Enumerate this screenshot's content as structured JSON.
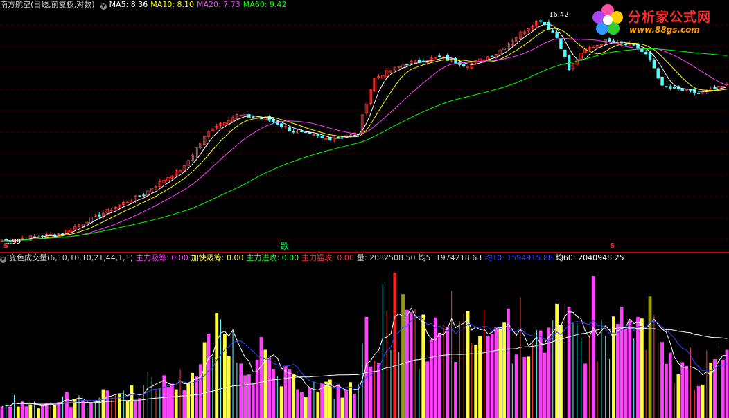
{
  "price_header": {
    "stock_title": "南方航空(日线,前复权,对数)",
    "ma5": "MA5: 8.36",
    "ma10": "MA10: 8.10",
    "ma20": "MA20: 7.73",
    "ma60": "MA60: 9.42"
  },
  "volume_header": {
    "indicator": "变色成交量(6,10,10,10,21,44,1,1)",
    "zhuli_xichou": "主力吸筹: 0.00",
    "jiakuai_xichou": "加快吸筹: 0.00",
    "zhuli_jingong": "主力进攻: 0.00",
    "zhuli_menggong": "主力猛攻: 0.00",
    "liang": "量: 2082508.50",
    "jun5": "均5: 1974218.63",
    "jun10": "均10: 1594915.88",
    "jun60": "均60: 2040948.25"
  },
  "price_markers": {
    "high_label": "16.42",
    "low_label": "1.99",
    "die": "跌",
    "s_left": "S",
    "s_right": "S"
  },
  "logo": {
    "brand": "分析家公式网",
    "url": "www.88gs.com",
    "icon": "flower-icon"
  },
  "colors": {
    "background": "#000000",
    "up_candle": "#ff3c3c",
    "down_candle": "#54ffff",
    "ma5": "#ffffff",
    "ma10": "#ffff00",
    "ma20": "#ff40ff",
    "ma60": "#00ff00",
    "vol_magenta": "#ff40ff",
    "vol_yellow": "#ffff40",
    "vol_olive": "#999900",
    "vol_red": "#ff2020",
    "vol_avg_white": "#ffffff",
    "vol_avg_blue": "#3344ff"
  },
  "chart_data": [
    {
      "type": "line",
      "panel": "price (candlestick, log scale)",
      "y_scale": "log",
      "ylim": [
        1.95,
        17.5
      ],
      "grid": "dotted horizontal",
      "bars": 180,
      "close_keypoints": [
        [
          0,
          2.0
        ],
        [
          15,
          2.15
        ],
        [
          25,
          2.6
        ],
        [
          35,
          3.1
        ],
        [
          45,
          4.0
        ],
        [
          52,
          5.8
        ],
        [
          58,
          6.5
        ],
        [
          65,
          6.3
        ],
        [
          72,
          5.6
        ],
        [
          80,
          5.2
        ],
        [
          88,
          5.5
        ],
        [
          92,
          9.2
        ],
        [
          100,
          10.6
        ],
        [
          108,
          11.2
        ],
        [
          115,
          10.4
        ],
        [
          122,
          11.6
        ],
        [
          128,
          14.0
        ],
        [
          133,
          16.0
        ],
        [
          137,
          13.5
        ],
        [
          140,
          10.0
        ],
        [
          144,
          12.0
        ],
        [
          150,
          13.2
        ],
        [
          156,
          12.6
        ],
        [
          160,
          11.0
        ],
        [
          163,
          8.5
        ],
        [
          168,
          8.2
        ],
        [
          172,
          8.0
        ],
        [
          176,
          8.3
        ],
        [
          179,
          8.6
        ]
      ],
      "series": [
        {
          "name": "MA5",
          "window": 5,
          "value": 8.36
        },
        {
          "name": "MA10",
          "window": 10,
          "value": 8.1
        },
        {
          "name": "MA20",
          "window": 20,
          "value": 7.73
        },
        {
          "name": "MA60",
          "window": 60,
          "value": 9.42
        }
      ],
      "annotations": [
        {
          "text": "16.42",
          "at": "high"
        },
        {
          "text": "1.99",
          "at": "low"
        }
      ]
    },
    {
      "type": "bar",
      "panel": "volume (变色成交量)",
      "bars": 180,
      "ylim": [
        0,
        3600000
      ],
      "volume_keypoints": [
        [
          0,
          0.35
        ],
        [
          20,
          0.45
        ],
        [
          38,
          0.8
        ],
        [
          48,
          1.1
        ],
        [
          52,
          2.0
        ],
        [
          58,
          1.9
        ],
        [
          64,
          1.2
        ],
        [
          75,
          0.8
        ],
        [
          88,
          0.7
        ],
        [
          90,
          2.0
        ],
        [
          96,
          2.1
        ],
        [
          110,
          2.0
        ],
        [
          128,
          2.3
        ],
        [
          135,
          2.2
        ],
        [
          145,
          2.1
        ],
        [
          155,
          2.2
        ],
        [
          160,
          1.7
        ],
        [
          170,
          1.1
        ],
        [
          179,
          1.5
        ]
      ],
      "series": [
        {
          "name": "量",
          "value": 2082508.5
        },
        {
          "name": "均5",
          "value": 1974218.63
        },
        {
          "name": "均10",
          "value": 1594915.88
        },
        {
          "name": "均60",
          "value": 2040948.25
        }
      ]
    }
  ]
}
